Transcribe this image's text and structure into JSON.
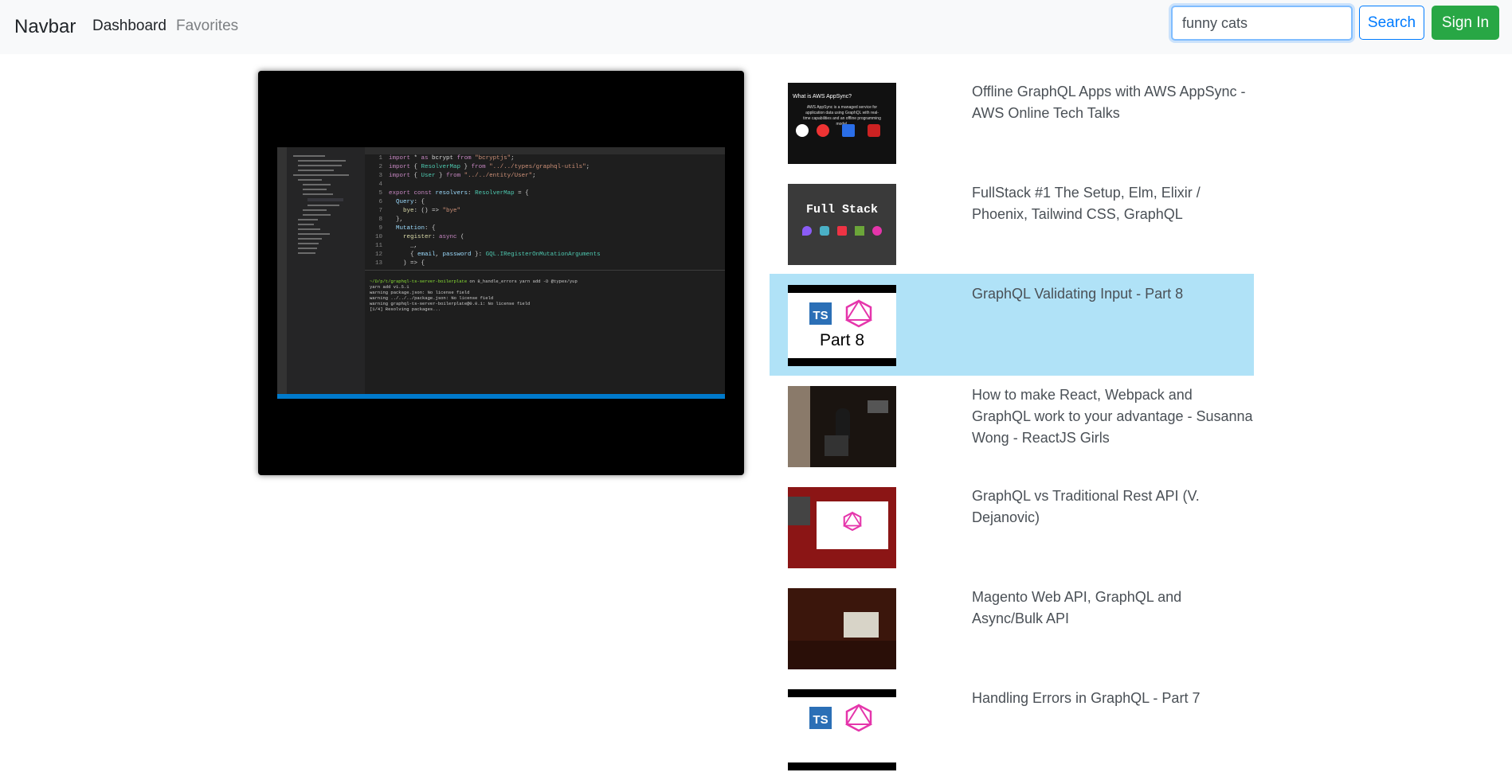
{
  "navbar": {
    "brand": "Navbar",
    "links": [
      "Dashboard",
      "Favorites"
    ],
    "search_value": "funny cats",
    "search_button": "Search",
    "signin_button": "Sign In"
  },
  "player": {
    "state": "playing"
  },
  "videos": [
    {
      "title": "Offline GraphQL Apps with AWS AppSync - AWS Online Tech Talks",
      "thumbnail": "aws-appsync-thumbnail",
      "active": false
    },
    {
      "title": "FullStack #1 The Setup, Elm, Elixir / Phoenix, Tailwind CSS, GraphQL",
      "thumbnail": "full-stack-thumbnail",
      "thumb_text": "Full Stack",
      "active": false
    },
    {
      "title": "GraphQL Validating Input - Part 8",
      "thumbnail": "ts-graphql-part8-thumbnail",
      "thumb_text": "Part 8",
      "thumb_badge": "TS",
      "active": true
    },
    {
      "title": "How to make React, Webpack and GraphQL work to your advantage - Susanna Wong - ReactJS Girls",
      "thumbnail": "conference-talk-thumbnail",
      "active": false
    },
    {
      "title": "GraphQL vs Traditional Rest API (V. Dejanovic)",
      "thumbnail": "devoxx-talk-thumbnail",
      "active": false
    },
    {
      "title": "Magento Web API, GraphQL and Async/Bulk API",
      "thumbnail": "meetup-talk-thumbnail",
      "active": false
    },
    {
      "title": "Handling Errors in GraphQL - Part 7",
      "thumbnail": "ts-graphql-part7-thumbnail",
      "thumb_badge": "TS",
      "active": false
    }
  ],
  "colors": {
    "primary": "#007bff",
    "success": "#28a745",
    "active_row": "#b0e2f7",
    "navbar_bg": "#f8f9fa"
  }
}
